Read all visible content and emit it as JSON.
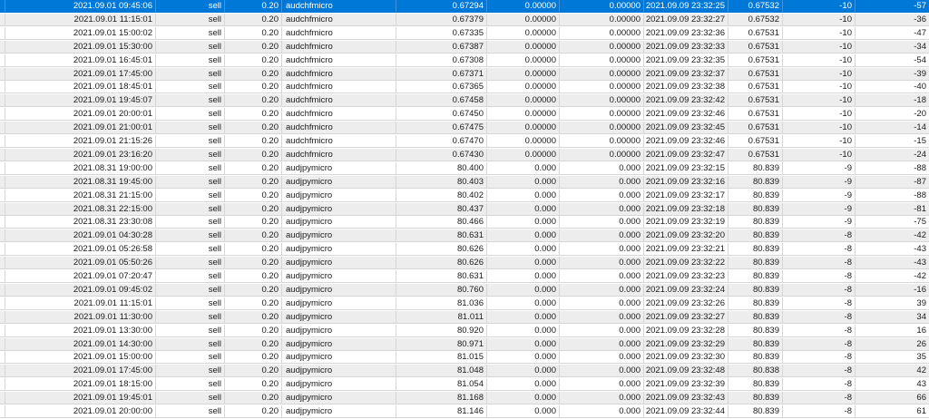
{
  "rows": [
    {
      "open_time": "2021.09.01 09:45:06",
      "type": "sell",
      "volume": "0.20",
      "symbol": "audchfmicro",
      "price": "0.67294",
      "sl": "0.00000",
      "tp": "0.00000",
      "close_time": "2021.09.09 23:32:25",
      "close_price": "0.67532",
      "swap": "-10",
      "profit": "-57",
      "selected": true
    },
    {
      "open_time": "2021.09.01 11:15:01",
      "type": "sell",
      "volume": "0.20",
      "symbol": "audchfmicro",
      "price": "0.67379",
      "sl": "0.00000",
      "tp": "0.00000",
      "close_time": "2021.09.09 23:32:27",
      "close_price": "0.67532",
      "swap": "-10",
      "profit": "-36"
    },
    {
      "open_time": "2021.09.01 15:00:02",
      "type": "sell",
      "volume": "0.20",
      "symbol": "audchfmicro",
      "price": "0.67335",
      "sl": "0.00000",
      "tp": "0.00000",
      "close_time": "2021.09.09 23:32:36",
      "close_price": "0.67531",
      "swap": "-10",
      "profit": "-47"
    },
    {
      "open_time": "2021.09.01 15:30:00",
      "type": "sell",
      "volume": "0.20",
      "symbol": "audchfmicro",
      "price": "0.67387",
      "sl": "0.00000",
      "tp": "0.00000",
      "close_time": "2021.09.09 23:32:33",
      "close_price": "0.67531",
      "swap": "-10",
      "profit": "-34"
    },
    {
      "open_time": "2021.09.01 16:45:01",
      "type": "sell",
      "volume": "0.20",
      "symbol": "audchfmicro",
      "price": "0.67308",
      "sl": "0.00000",
      "tp": "0.00000",
      "close_time": "2021.09.09 23:32:35",
      "close_price": "0.67531",
      "swap": "-10",
      "profit": "-54"
    },
    {
      "open_time": "2021.09.01 17:45:00",
      "type": "sell",
      "volume": "0.20",
      "symbol": "audchfmicro",
      "price": "0.67371",
      "sl": "0.00000",
      "tp": "0.00000",
      "close_time": "2021.09.09 23:32:37",
      "close_price": "0.67531",
      "swap": "-10",
      "profit": "-39"
    },
    {
      "open_time": "2021.09.01 18:45:01",
      "type": "sell",
      "volume": "0.20",
      "symbol": "audchfmicro",
      "price": "0.67365",
      "sl": "0.00000",
      "tp": "0.00000",
      "close_time": "2021.09.09 23:32:38",
      "close_price": "0.67531",
      "swap": "-10",
      "profit": "-40"
    },
    {
      "open_time": "2021.09.01 19:45:07",
      "type": "sell",
      "volume": "0.20",
      "symbol": "audchfmicro",
      "price": "0.67458",
      "sl": "0.00000",
      "tp": "0.00000",
      "close_time": "2021.09.09 23:32:42",
      "close_price": "0.67531",
      "swap": "-10",
      "profit": "-18"
    },
    {
      "open_time": "2021.09.01 20:00:01",
      "type": "sell",
      "volume": "0.20",
      "symbol": "audchfmicro",
      "price": "0.67450",
      "sl": "0.00000",
      "tp": "0.00000",
      "close_time": "2021.09.09 23:32:46",
      "close_price": "0.67531",
      "swap": "-10",
      "profit": "-20"
    },
    {
      "open_time": "2021.09.01 21:00:01",
      "type": "sell",
      "volume": "0.20",
      "symbol": "audchfmicro",
      "price": "0.67475",
      "sl": "0.00000",
      "tp": "0.00000",
      "close_time": "2021.09.09 23:32:45",
      "close_price": "0.67531",
      "swap": "-10",
      "profit": "-14"
    },
    {
      "open_time": "2021.09.01 21:15:26",
      "type": "sell",
      "volume": "0.20",
      "symbol": "audchfmicro",
      "price": "0.67470",
      "sl": "0.00000",
      "tp": "0.00000",
      "close_time": "2021.09.09 23:32:46",
      "close_price": "0.67531",
      "swap": "-10",
      "profit": "-15"
    },
    {
      "open_time": "2021.09.01 23:16:20",
      "type": "sell",
      "volume": "0.20",
      "symbol": "audchfmicro",
      "price": "0.67430",
      "sl": "0.00000",
      "tp": "0.00000",
      "close_time": "2021.09.09 23:32:47",
      "close_price": "0.67531",
      "swap": "-10",
      "profit": "-24"
    },
    {
      "open_time": "2021.08.31 19:00:00",
      "type": "sell",
      "volume": "0.20",
      "symbol": "audjpymicro",
      "price": "80.400",
      "sl": "0.000",
      "tp": "0.000",
      "close_time": "2021.09.09 23:32:15",
      "close_price": "80.839",
      "swap": "-9",
      "profit": "-88"
    },
    {
      "open_time": "2021.08.31 19:45:00",
      "type": "sell",
      "volume": "0.20",
      "symbol": "audjpymicro",
      "price": "80.403",
      "sl": "0.000",
      "tp": "0.000",
      "close_time": "2021.09.09 23:32:16",
      "close_price": "80.839",
      "swap": "-9",
      "profit": "-87"
    },
    {
      "open_time": "2021.08.31 21:15:00",
      "type": "sell",
      "volume": "0.20",
      "symbol": "audjpymicro",
      "price": "80.402",
      "sl": "0.000",
      "tp": "0.000",
      "close_time": "2021.09.09 23:32:17",
      "close_price": "80.839",
      "swap": "-9",
      "profit": "-88"
    },
    {
      "open_time": "2021.08.31 22:15:00",
      "type": "sell",
      "volume": "0.20",
      "symbol": "audjpymicro",
      "price": "80.437",
      "sl": "0.000",
      "tp": "0.000",
      "close_time": "2021.09.09 23:32:18",
      "close_price": "80.839",
      "swap": "-9",
      "profit": "-81"
    },
    {
      "open_time": "2021.08.31 23:30:08",
      "type": "sell",
      "volume": "0.20",
      "symbol": "audjpymicro",
      "price": "80.466",
      "sl": "0.000",
      "tp": "0.000",
      "close_time": "2021.09.09 23:32:19",
      "close_price": "80.839",
      "swap": "-9",
      "profit": "-75"
    },
    {
      "open_time": "2021.09.01 04:30:28",
      "type": "sell",
      "volume": "0.20",
      "symbol": "audjpymicro",
      "price": "80.631",
      "sl": "0.000",
      "tp": "0.000",
      "close_time": "2021.09.09 23:32:20",
      "close_price": "80.839",
      "swap": "-8",
      "profit": "-42"
    },
    {
      "open_time": "2021.09.01 05:26:58",
      "type": "sell",
      "volume": "0.20",
      "symbol": "audjpymicro",
      "price": "80.626",
      "sl": "0.000",
      "tp": "0.000",
      "close_time": "2021.09.09 23:32:21",
      "close_price": "80.839",
      "swap": "-8",
      "profit": "-43"
    },
    {
      "open_time": "2021.09.01 05:50:26",
      "type": "sell",
      "volume": "0.20",
      "symbol": "audjpymicro",
      "price": "80.626",
      "sl": "0.000",
      "tp": "0.000",
      "close_time": "2021.09.09 23:32:22",
      "close_price": "80.839",
      "swap": "-8",
      "profit": "-43"
    },
    {
      "open_time": "2021.09.01 07:20:47",
      "type": "sell",
      "volume": "0.20",
      "symbol": "audjpymicro",
      "price": "80.631",
      "sl": "0.000",
      "tp": "0.000",
      "close_time": "2021.09.09 23:32:23",
      "close_price": "80.839",
      "swap": "-8",
      "profit": "-42"
    },
    {
      "open_time": "2021.09.01 09:45:02",
      "type": "sell",
      "volume": "0.20",
      "symbol": "audjpymicro",
      "price": "80.760",
      "sl": "0.000",
      "tp": "0.000",
      "close_time": "2021.09.09 23:32:24",
      "close_price": "80.839",
      "swap": "-8",
      "profit": "-16"
    },
    {
      "open_time": "2021.09.01 11:15:01",
      "type": "sell",
      "volume": "0.20",
      "symbol": "audjpymicro",
      "price": "81.036",
      "sl": "0.000",
      "tp": "0.000",
      "close_time": "2021.09.09 23:32:26",
      "close_price": "80.839",
      "swap": "-8",
      "profit": "39"
    },
    {
      "open_time": "2021.09.01 11:30:00",
      "type": "sell",
      "volume": "0.20",
      "symbol": "audjpymicro",
      "price": "81.011",
      "sl": "0.000",
      "tp": "0.000",
      "close_time": "2021.09.09 23:32:27",
      "close_price": "80.839",
      "swap": "-8",
      "profit": "34"
    },
    {
      "open_time": "2021.09.01 13:30:00",
      "type": "sell",
      "volume": "0.20",
      "symbol": "audjpymicro",
      "price": "80.920",
      "sl": "0.000",
      "tp": "0.000",
      "close_time": "2021.09.09 23:32:28",
      "close_price": "80.839",
      "swap": "-8",
      "profit": "16"
    },
    {
      "open_time": "2021.09.01 14:30:00",
      "type": "sell",
      "volume": "0.20",
      "symbol": "audjpymicro",
      "price": "80.971",
      "sl": "0.000",
      "tp": "0.000",
      "close_time": "2021.09.09 23:32:29",
      "close_price": "80.839",
      "swap": "-8",
      "profit": "26"
    },
    {
      "open_time": "2021.09.01 15:00:00",
      "type": "sell",
      "volume": "0.20",
      "symbol": "audjpymicro",
      "price": "81.015",
      "sl": "0.000",
      "tp": "0.000",
      "close_time": "2021.09.09 23:32:30",
      "close_price": "80.839",
      "swap": "-8",
      "profit": "35"
    },
    {
      "open_time": "2021.09.01 17:45:00",
      "type": "sell",
      "volume": "0.20",
      "symbol": "audjpymicro",
      "price": "81.048",
      "sl": "0.000",
      "tp": "0.000",
      "close_time": "2021.09.09 23:32:48",
      "close_price": "80.838",
      "swap": "-8",
      "profit": "42"
    },
    {
      "open_time": "2021.09.01 18:15:00",
      "type": "sell",
      "volume": "0.20",
      "symbol": "audjpymicro",
      "price": "81.054",
      "sl": "0.000",
      "tp": "0.000",
      "close_time": "2021.09.09 23:32:39",
      "close_price": "80.839",
      "swap": "-8",
      "profit": "43"
    },
    {
      "open_time": "2021.09.01 19:45:01",
      "type": "sell",
      "volume": "0.20",
      "symbol": "audjpymicro",
      "price": "81.168",
      "sl": "0.000",
      "tp": "0.000",
      "close_time": "2021.09.09 23:32:43",
      "close_price": "80.839",
      "swap": "-8",
      "profit": "66"
    },
    {
      "open_time": "2021.09.01 20:00:00",
      "type": "sell",
      "volume": "0.20",
      "symbol": "audjpymicro",
      "price": "81.146",
      "sl": "0.000",
      "tp": "0.000",
      "close_time": "2021.09.09 23:32:44",
      "close_price": "80.839",
      "swap": "-8",
      "profit": "61"
    }
  ]
}
